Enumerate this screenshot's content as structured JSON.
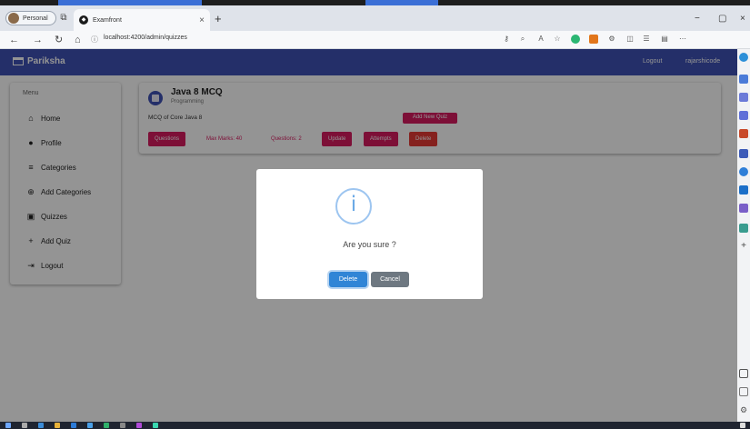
{
  "browser": {
    "profile_label": "Personal",
    "tab_title": "Examfront",
    "url": "localhost:4200/admin/quizzes"
  },
  "app": {
    "brand": "Pariksha",
    "nav_links": [
      "Logout",
      "rajarshicode"
    ]
  },
  "sidebar": {
    "heading": "Menu",
    "items": [
      {
        "label": "Home",
        "icon": "home-icon"
      },
      {
        "label": "Profile",
        "icon": "account-circle-icon"
      },
      {
        "label": "Categories",
        "icon": "list-icon"
      },
      {
        "label": "Add Categories",
        "icon": "add-circle-icon"
      },
      {
        "label": "Quizzes",
        "icon": "library-books-icon"
      },
      {
        "label": "Add Quiz",
        "icon": "plus-icon"
      },
      {
        "label": "Logout",
        "icon": "logout-icon"
      }
    ]
  },
  "quiz": {
    "title": "Java 8 MCQ",
    "category": "Programming",
    "description": "MCQ of Core Java 8",
    "buttons": {
      "questions": "Questions",
      "max_marks": "Max Marks: 40",
      "questions_count": "Questions: 2",
      "update": "Update",
      "attempts": "Attempts",
      "delete": "Delete"
    }
  },
  "add_quiz_button": "Add New Quiz",
  "dialog": {
    "icon": "info-icon",
    "message": "Are you sure ?",
    "confirm_label": "Delete",
    "cancel_label": "Cancel"
  },
  "colors": {
    "navbar": "#3f51b5",
    "accent": "#d81b60",
    "danger": "#e53935",
    "confirm": "#3085d6",
    "cancel": "#6e7881"
  }
}
